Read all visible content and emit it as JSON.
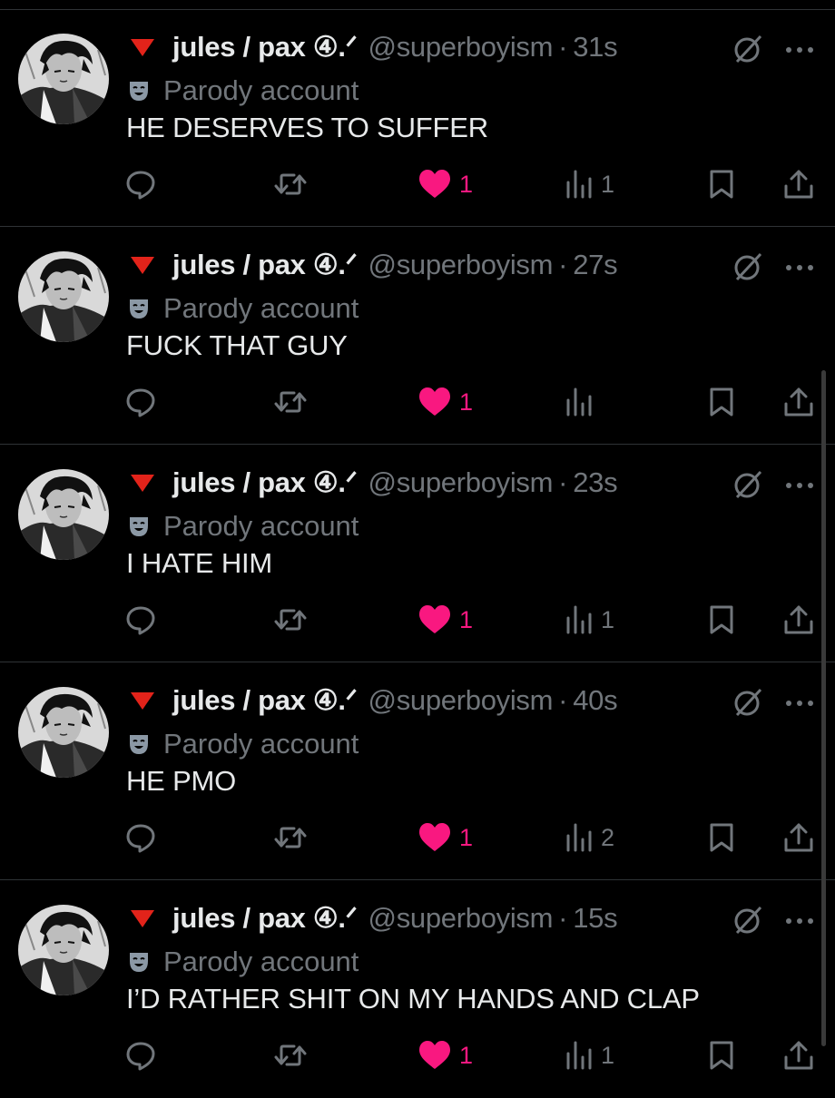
{
  "colors": {
    "background": "#000000",
    "primary_text": "#e7e9ea",
    "secondary_text": "#71767b",
    "like_pink": "#f91880",
    "divider": "#2f3336",
    "flag_red": "#e2231a"
  },
  "icons": {
    "flag": "red-triangle-icon",
    "parody": "theater-mask-icon",
    "grok": "grok-icon",
    "more": "more-horizontal-icon",
    "reply": "reply-icon",
    "repost": "repost-icon",
    "like": "heart-filled-icon",
    "views": "analytics-icon",
    "bookmark": "bookmark-icon",
    "share": "share-icon"
  },
  "posts": [
    {
      "display_name": "jules / pax ④.ᐟ",
      "handle": "@superboyism",
      "separator": "·",
      "time": "31s",
      "parody_label": "Parody account",
      "text": "HE DESERVES TO SUFFER",
      "likes": "1",
      "views": "1"
    },
    {
      "display_name": "jules / pax ④.ᐟ",
      "handle": "@superboyism",
      "separator": "·",
      "time": "27s",
      "parody_label": "Parody account",
      "text": "FUCK THAT GUY",
      "likes": "1",
      "views": ""
    },
    {
      "display_name": "jules / pax ④.ᐟ",
      "handle": "@superboyism",
      "separator": "·",
      "time": "23s",
      "parody_label": "Parody account",
      "text": "I HATE HIM",
      "likes": "1",
      "views": "1"
    },
    {
      "display_name": "jules / pax ④.ᐟ",
      "handle": "@superboyism",
      "separator": "·",
      "time": "40s",
      "parody_label": "Parody account",
      "text": "HE PMO",
      "likes": "1",
      "views": "2"
    },
    {
      "display_name": "jules / pax ④.ᐟ",
      "handle": "@superboyism",
      "separator": "·",
      "time": "15s",
      "parody_label": "Parody account",
      "text": "I’D RATHER SHIT ON MY HANDS AND CLAP",
      "likes": "1",
      "views": "1"
    }
  ]
}
